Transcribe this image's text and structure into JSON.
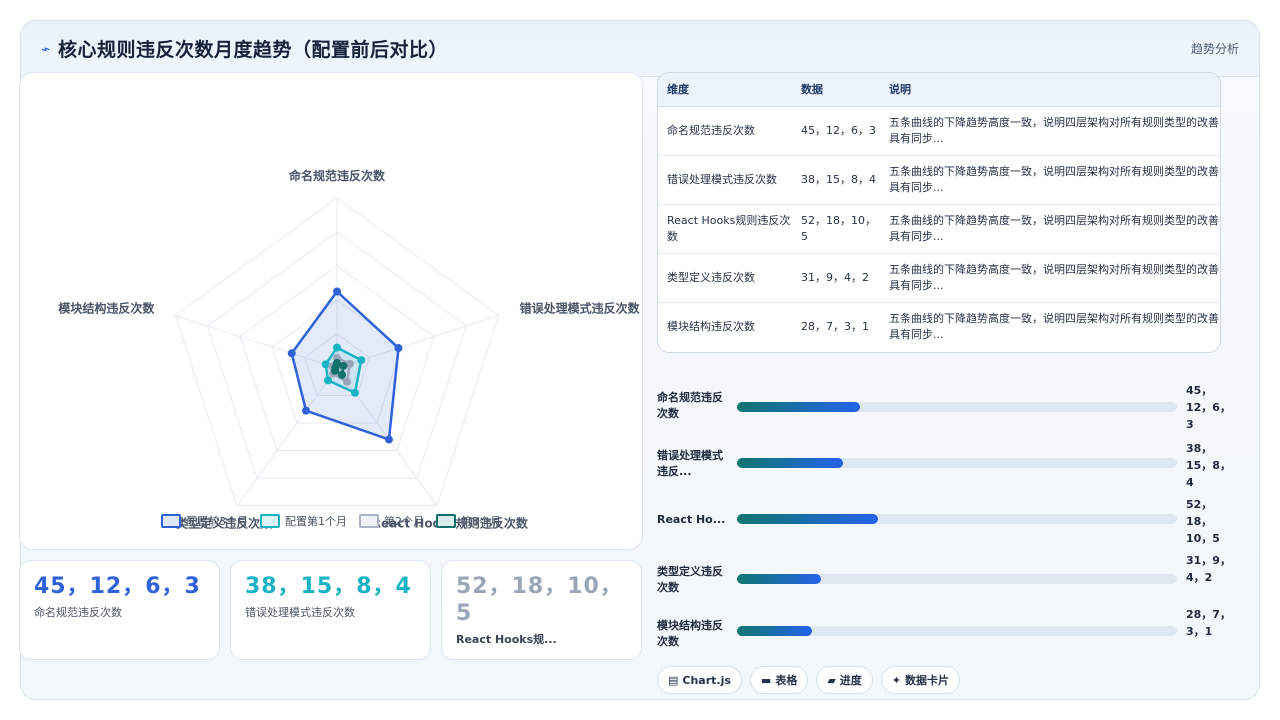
{
  "header": {
    "icon": "trend-line-icon",
    "title": "核心规则违反次数月度趋势（配置前后对比）",
    "subtitle": "趋势分析"
  },
  "chart_data": {
    "type": "radar",
    "axes": [
      "命名规范违反次数",
      "错误处理模式违反次数",
      "React Hooks规则违反次数",
      "类型定义违反次数",
      "模块结构违反次数"
    ],
    "rmax": 100,
    "rings": 5,
    "series": [
      {
        "name": "配置前3个月",
        "values": [
          45,
          38,
          52,
          31,
          28
        ],
        "stroke": "#2f61d9",
        "fill": "rgba(59,110,230,0.14)"
      },
      {
        "name": "配置第1个月",
        "values": [
          12,
          15,
          18,
          9,
          7
        ],
        "stroke": "#17b3c4",
        "fill": "rgba(23,179,196,0.12)"
      },
      {
        "name": "第2个月",
        "values": [
          6,
          8,
          10,
          4,
          3
        ],
        "stroke": "#9aa6b8",
        "fill": "rgba(154,166,184,0.18)"
      },
      {
        "name": "第3个月",
        "values": [
          3,
          4,
          5,
          2,
          1
        ],
        "stroke": "#12706a",
        "fill": "rgba(18,112,106,0.18)"
      }
    ]
  },
  "legend": [
    {
      "label": "配置前3个月",
      "color": "#2f61d9",
      "bg": "#dfe8fb"
    },
    {
      "label": "配置第1个月",
      "color": "#17b3c4",
      "bg": "#dcf5f7"
    },
    {
      "label": "第2个月",
      "color": "#aab4c4",
      "bg": "#eef1f5"
    },
    {
      "label": "第3个月",
      "color": "#12706a",
      "bg": "#dbeeed"
    }
  ],
  "cards": [
    {
      "value": "45，12，6，3",
      "label": "命名规范违反次数",
      "color": "#2f61d9"
    },
    {
      "value": "38，15，8，4",
      "label": "错误处理模式违反次数",
      "color": "#17b3c4"
    },
    {
      "value": "52，18，10，5",
      "label": "React Hooks规...",
      "color": "#9aa6b8"
    }
  ],
  "table": {
    "headers": [
      "维度",
      "数据",
      "说明"
    ],
    "rows": [
      [
        "命名规范违反次数",
        "45，12，6，3",
        "五条曲线的下降趋势高度一致，说明四层架构对所有规则类型的改善具有同步..."
      ],
      [
        "错误处理模式违反次数",
        "38，15，8，4",
        "五条曲线的下降趋势高度一致，说明四层架构对所有规则类型的改善具有同步..."
      ],
      [
        "React Hooks规则违反次数",
        "52，18，10，5",
        "五条曲线的下降趋势高度一致，说明四层架构对所有规则类型的改善具有同步..."
      ],
      [
        "类型定义违反次数",
        "31，9，4，2",
        "五条曲线的下降趋势高度一致，说明四层架构对所有规则类型的改善具有同步..."
      ],
      [
        "模块结构违反次数",
        "28，7，3，1",
        "五条曲线的下降趋势高度一致，说明四层架构对所有规则类型的改善具有同步..."
      ]
    ]
  },
  "progress": [
    {
      "label": "命名规范违反次数",
      "value": "45，12，6，3",
      "percent": 28
    },
    {
      "label": "错误处理模式违反...",
      "value": "38，15，8，4",
      "percent": 24
    },
    {
      "label": "React Ho...",
      "value": "52，18，10，5",
      "percent": 32
    },
    {
      "label": "类型定义违反次数",
      "value": "31，9，4，2",
      "percent": 19
    },
    {
      "label": "模块结构违反次数",
      "value": "28，7，3，1",
      "percent": 17
    }
  ],
  "chips": [
    {
      "icon": "chart-icon",
      "glyph": "▤",
      "label": "Chart.js"
    },
    {
      "icon": "table-icon",
      "glyph": "▬",
      "label": "表格"
    },
    {
      "icon": "progress-icon",
      "glyph": "▰",
      "label": "进度"
    },
    {
      "icon": "sparkle-icon",
      "glyph": "✦",
      "label": "数据卡片"
    }
  ]
}
